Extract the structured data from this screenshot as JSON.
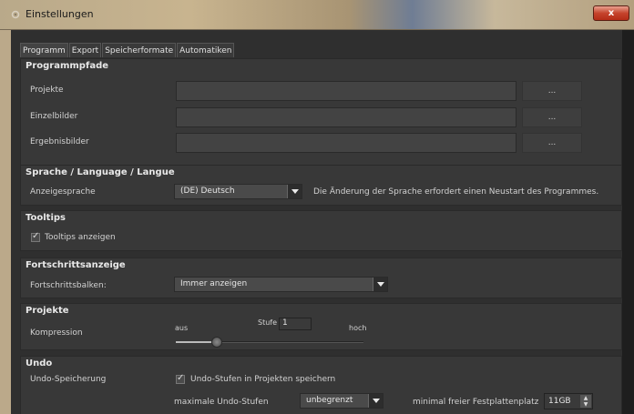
{
  "window": {
    "title": "Einstellungen",
    "close_label": "x"
  },
  "tabs": [
    {
      "label": "Programm"
    },
    {
      "label": "Export"
    },
    {
      "label": "Speicherformate"
    },
    {
      "label": "Automatiken"
    }
  ],
  "programmpfade": {
    "heading": "Programmpfade",
    "rows": [
      {
        "label": "Projekte",
        "value": "",
        "browse_label": "..."
      },
      {
        "label": "Einzelbilder",
        "value": "",
        "browse_label": "..."
      },
      {
        "label": "Ergebnisbilder",
        "value": "",
        "browse_label": "..."
      }
    ]
  },
  "sprache": {
    "heading": "Sprache / Language / Langue",
    "label": "Anzeigesprache",
    "selected": "(DE) Deutsch",
    "note": "Die Änderung der Sprache erfordert einen Neustart des Programmes."
  },
  "tooltips": {
    "heading": "Tooltips",
    "checkbox_label": "Tooltips anzeigen",
    "checked": true
  },
  "fortschritt": {
    "heading": "Fortschrittsanzeige",
    "label": "Fortschrittsbalken:",
    "selected": "Immer anzeigen"
  },
  "projekte": {
    "heading": "Projekte",
    "label": "Kompression",
    "min_label": "aus",
    "max_label": "hoch",
    "stufe_label": "Stufe",
    "stufe_value": "1",
    "slider_level": 0.22
  },
  "undo": {
    "heading": "Undo",
    "label": "Undo-Speicherung",
    "checkbox_label": "Undo-Stufen in Projekten speichern",
    "checked": true,
    "max_label": "maximale Undo-Stufen",
    "max_selected": "unbegrenzt",
    "disk_label": "minimal freier Festplattenplatz",
    "disk_value": "11GB"
  }
}
